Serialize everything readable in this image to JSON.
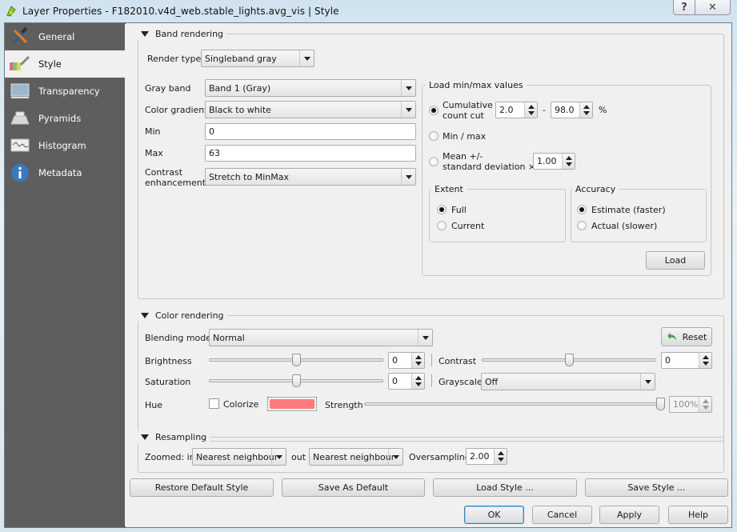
{
  "window": {
    "title": "Layer Properties - F182010.v4d_web.stable_lights.avg_vis | Style",
    "help_label": "?",
    "close_label": "✕"
  },
  "sidebar": {
    "items": [
      {
        "label": "General",
        "icon": "tools-icon",
        "active": false
      },
      {
        "label": "Style",
        "icon": "paintbrush-icon",
        "active": true
      },
      {
        "label": "Transparency",
        "icon": "transparency-icon",
        "active": false
      },
      {
        "label": "Pyramids",
        "icon": "pyramids-icon",
        "active": false
      },
      {
        "label": "Histogram",
        "icon": "histogram-icon",
        "active": false
      },
      {
        "label": "Metadata",
        "icon": "info-icon",
        "active": false
      }
    ]
  },
  "band_rendering": {
    "title": "Band rendering",
    "render_type_label": "Render type",
    "render_type_value": "Singleband gray",
    "gray_band_label": "Gray band",
    "gray_band_value": "Band 1 (Gray)",
    "color_gradient_label": "Color gradient",
    "color_gradient_value": "Black to white",
    "min_label": "Min",
    "min_value": "0",
    "max_label": "Max",
    "max_value": "63",
    "contrast_label_1": "Contrast",
    "contrast_label_2": "enhancement",
    "contrast_value": "Stretch to MinMax",
    "load_minmax": {
      "title": "Load min/max values",
      "cumulative_label_1": "Cumulative",
      "cumulative_label_2": "count cut",
      "cumulative_from": "2.0",
      "cumulative_dash": "-",
      "cumulative_to": "98.0",
      "percent": "%",
      "minmax_label": "Min / max",
      "mean_label_1": "Mean +/-",
      "mean_label_2": "standard deviation ×",
      "mean_value": "1.00",
      "selected": "cumulative",
      "extent": {
        "title": "Extent",
        "full_label": "Full",
        "current_label": "Current",
        "selected": "full"
      },
      "accuracy": {
        "title": "Accuracy",
        "estimate_label": "Estimate (faster)",
        "actual_label": "Actual (slower)",
        "selected": "estimate"
      },
      "load_button": "Load"
    }
  },
  "color_rendering": {
    "title": "Color rendering",
    "blending_label": "Blending mode",
    "blending_value": "Normal",
    "reset_button": "Reset",
    "brightness_label": "Brightness",
    "brightness_value": "0",
    "brightness_slider_fraction": 0.5,
    "contrast_label": "Contrast",
    "contrast_value": "0",
    "contrast_slider_fraction": 0.5,
    "saturation_label": "Saturation",
    "saturation_value": "0",
    "saturation_slider_fraction": 0.5,
    "grayscale_label": "Grayscale",
    "grayscale_value": "Off",
    "hue_label": "Hue",
    "colorize_label": "Colorize",
    "colorize_checked": false,
    "colorize_color": "#ff7c7c",
    "strength_label": "Strength",
    "strength_value": "100%",
    "strength_slider_fraction": 1.0
  },
  "resampling": {
    "title": "Resampling",
    "zoomed_in_label": "Zoomed: in",
    "zoomed_in_value": "Nearest neighbour",
    "out_label": "out",
    "zoomed_out_value": "Nearest neighbour",
    "oversampling_label": "Oversampling",
    "oversampling_value": "2.00"
  },
  "style_buttons": {
    "restore_default": "Restore Default Style",
    "save_as_default": "Save As Default",
    "load_style": "Load Style ...",
    "save_style": "Save Style ..."
  },
  "dialog_buttons": {
    "ok": "OK",
    "cancel": "Cancel",
    "apply": "Apply",
    "help": "Help"
  }
}
